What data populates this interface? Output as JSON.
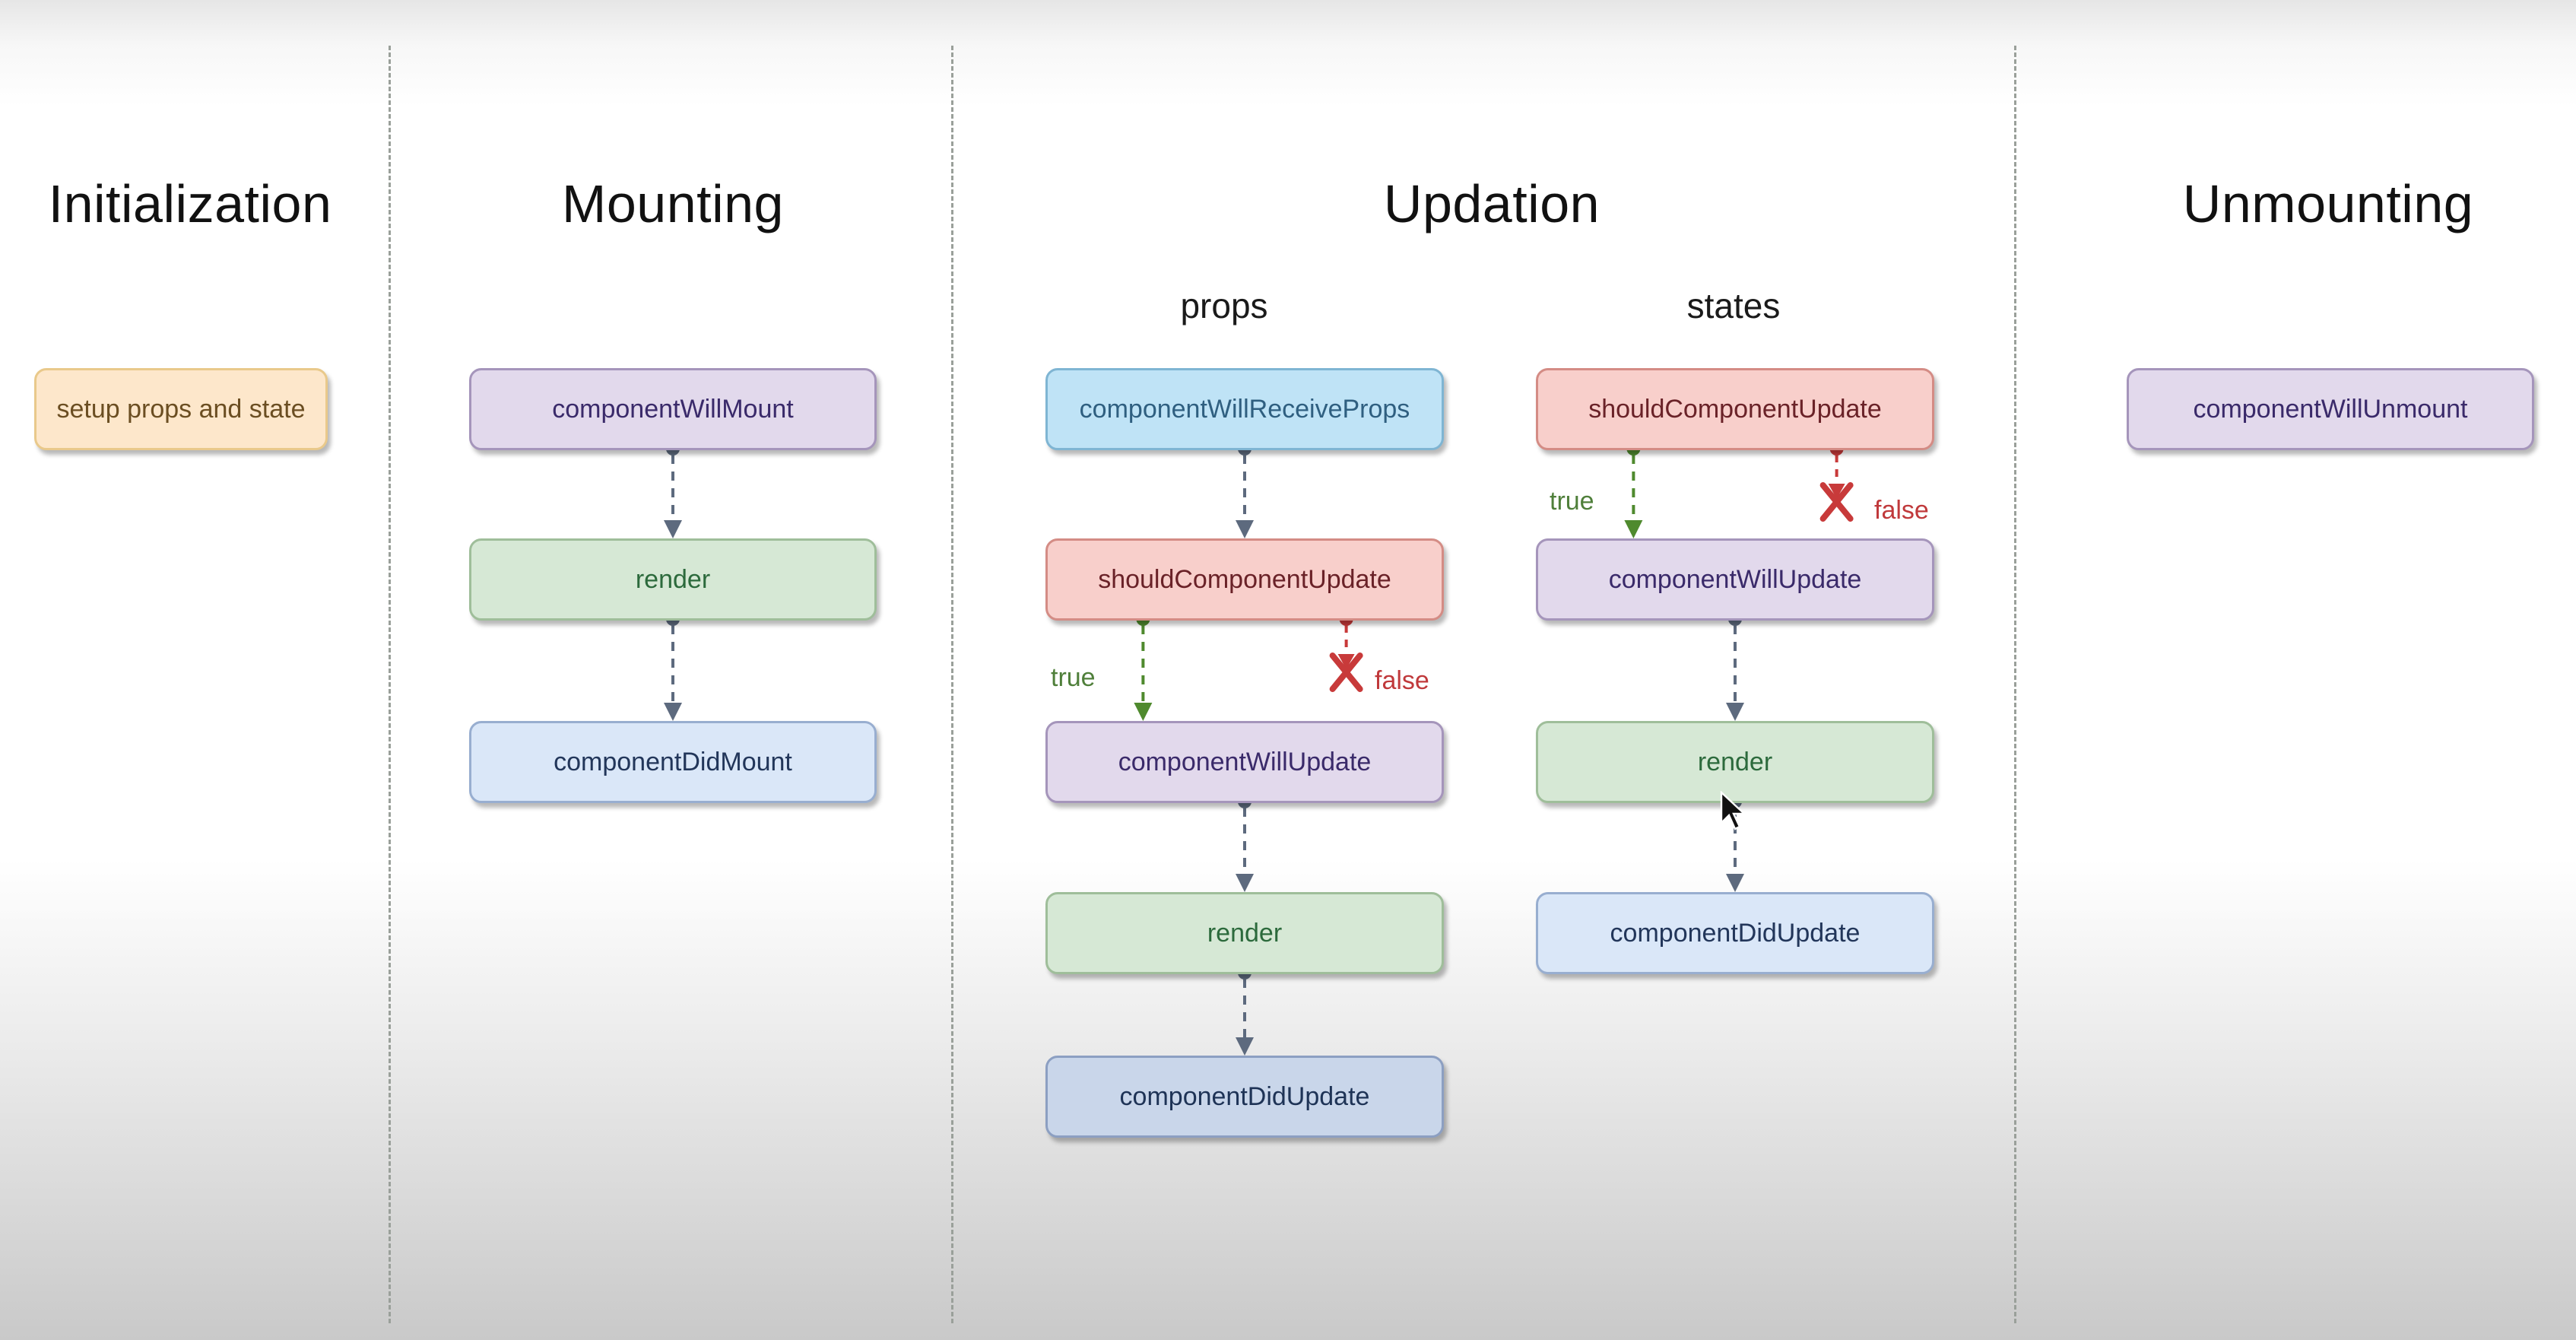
{
  "phases": {
    "initialization": "Initialization",
    "mounting": "Mounting",
    "updation": "Updation",
    "unmounting": "Unmounting"
  },
  "updation_subgroups": {
    "props": "props",
    "states": "states"
  },
  "nodes": {
    "setup": "setup props and state",
    "mount_will": "componentWillMount",
    "mount_render": "render",
    "mount_did": "componentDidMount",
    "props_wrp": "componentWillReceiveProps",
    "props_scu": "shouldComponentUpdate",
    "props_wu": "componentWillUpdate",
    "props_render": "render",
    "props_du": "componentDidUpdate",
    "states_scu": "shouldComponentUpdate",
    "states_wu": "componentWillUpdate",
    "states_render": "render",
    "states_du": "componentDidUpdate",
    "unmount_will": "componentWillUnmount"
  },
  "edge_labels": {
    "true": "true",
    "false": "false"
  },
  "colors": {
    "connector": "#5d6a7e",
    "true_branch": "#4f8a2e",
    "false_branch": "#c83a3a",
    "divider": "#9aa09a"
  },
  "edges": [
    {
      "from": "mount_will",
      "to": "mount_render",
      "kind": "normal"
    },
    {
      "from": "mount_render",
      "to": "mount_did",
      "kind": "normal"
    },
    {
      "from": "props_wrp",
      "to": "props_scu",
      "kind": "normal"
    },
    {
      "from": "props_scu",
      "to": "props_wu",
      "kind": "true"
    },
    {
      "from": "props_scu",
      "to": null,
      "kind": "false"
    },
    {
      "from": "props_wu",
      "to": "props_render",
      "kind": "normal"
    },
    {
      "from": "props_render",
      "to": "props_du",
      "kind": "normal"
    },
    {
      "from": "states_scu",
      "to": "states_wu",
      "kind": "true"
    },
    {
      "from": "states_scu",
      "to": null,
      "kind": "false"
    },
    {
      "from": "states_wu",
      "to": "states_render",
      "kind": "normal"
    },
    {
      "from": "states_render",
      "to": "states_du",
      "kind": "normal"
    }
  ]
}
